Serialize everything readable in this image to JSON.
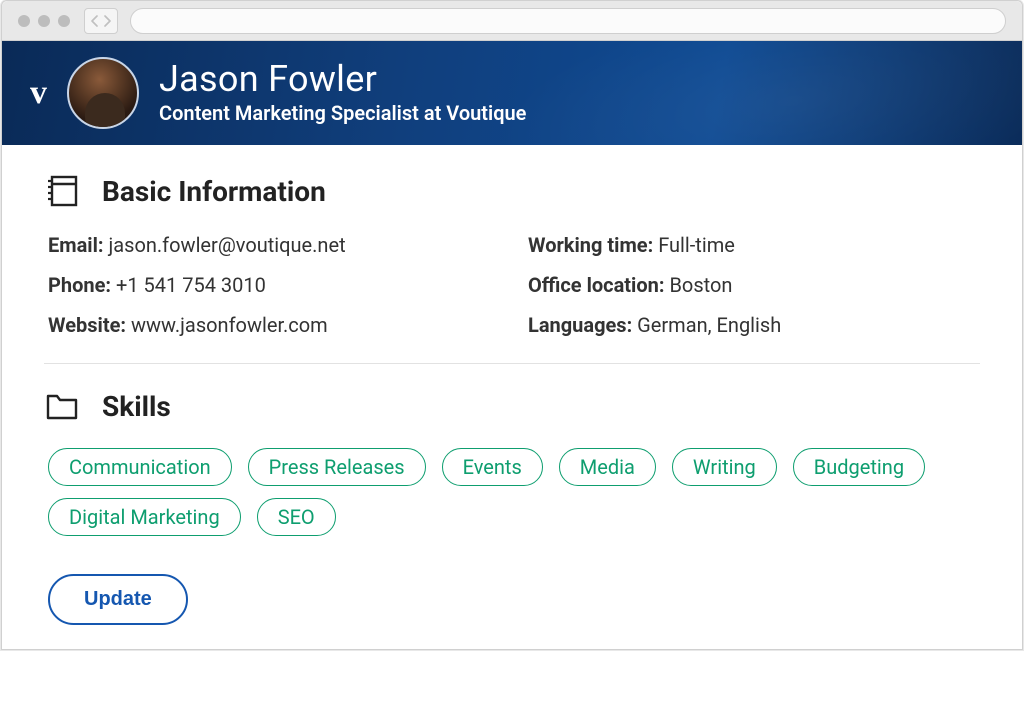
{
  "profile": {
    "logo_text": "v",
    "name": "Jason Fowler",
    "subtitle": "Content Marketing Specialist at Voutique"
  },
  "sections": {
    "basic": {
      "title": "Basic Information",
      "fields": {
        "email": {
          "label": "Email:",
          "value": "jason.fowler@voutique.net"
        },
        "phone": {
          "label": "Phone:",
          "value": "+1 541 754 3010"
        },
        "website": {
          "label": "Website:",
          "value": "www.jasonfowler.com"
        },
        "working_time": {
          "label": "Working time:",
          "value": "Full-time"
        },
        "office_location": {
          "label": "Office location:",
          "value": "Boston"
        },
        "languages": {
          "label": "Languages:",
          "value": "German, English"
        }
      }
    },
    "skills": {
      "title": "Skills",
      "items": [
        "Communication",
        "Press Releases",
        "Events",
        "Media",
        "Writing",
        "Budgeting",
        "Digital Marketing",
        "SEO"
      ]
    }
  },
  "buttons": {
    "update": "Update"
  },
  "colors": {
    "header_bg": "#0e3e7e",
    "skill_border": "#0e9e6f",
    "update_border": "#1557b0"
  }
}
